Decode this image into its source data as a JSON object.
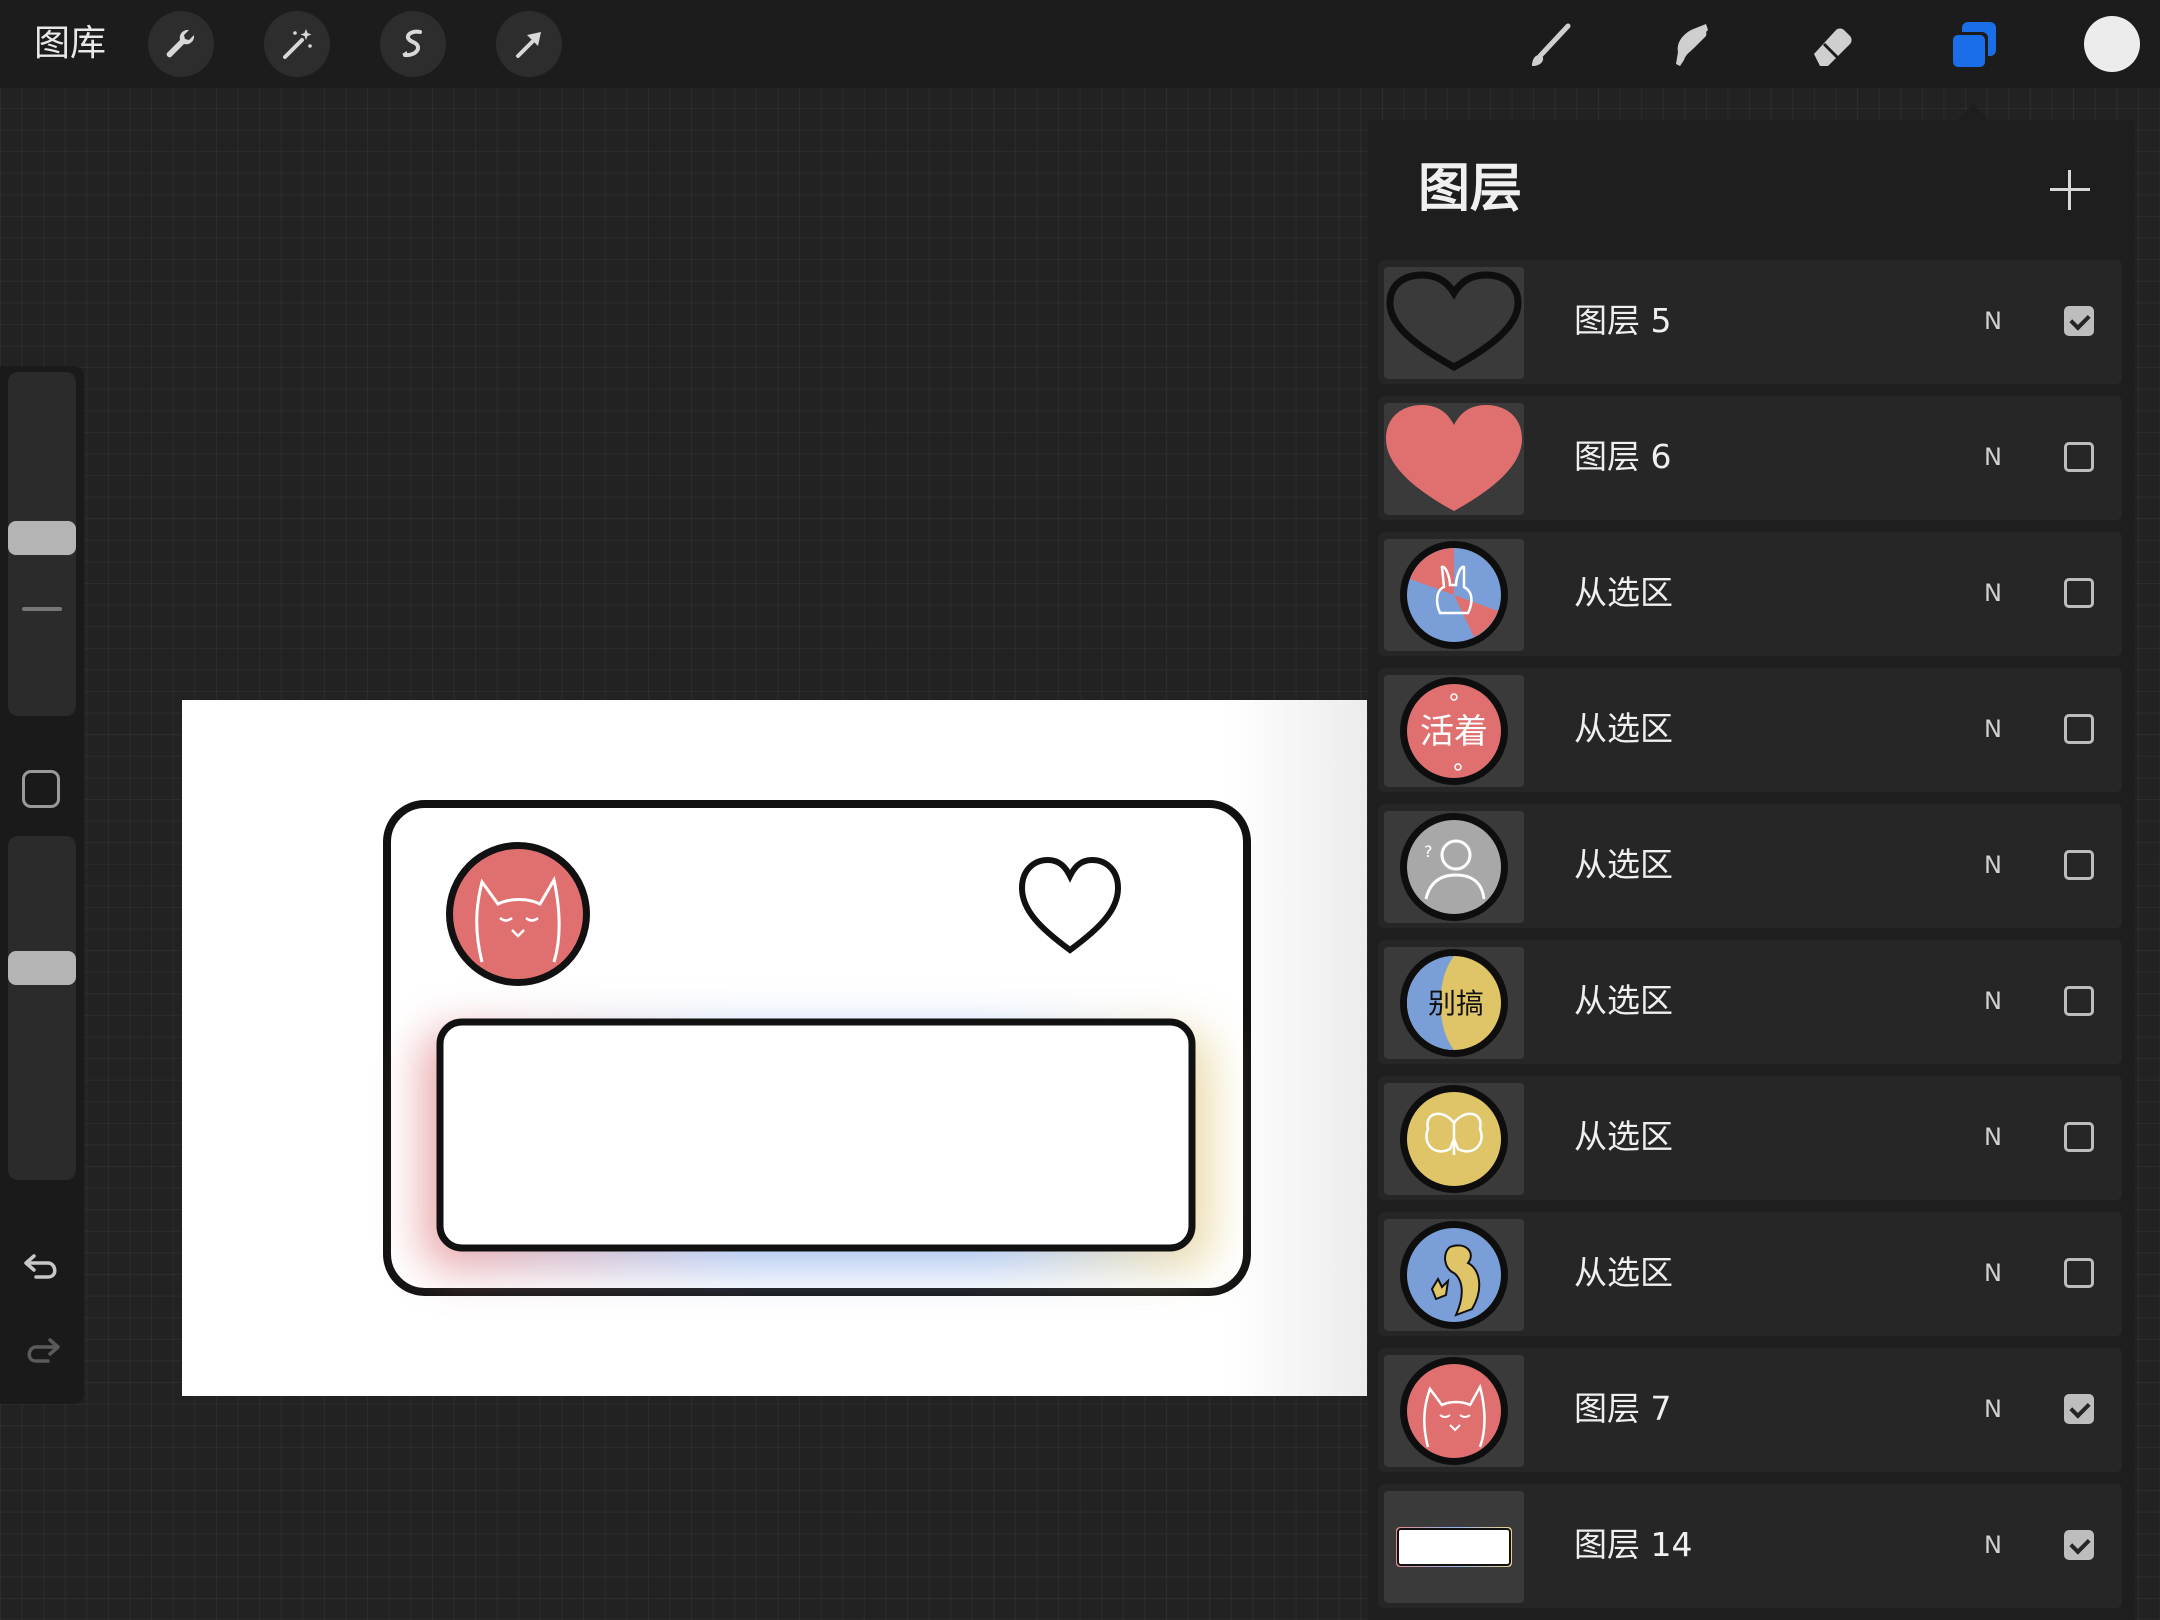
{
  "toolbar": {
    "gallery_label": "图库",
    "left_tools": [
      "wrench-icon",
      "magic-wand-icon",
      "selection-icon",
      "transform-arrow-icon"
    ],
    "right_tools": [
      "brush-icon",
      "smudge-icon",
      "eraser-icon",
      "layers-icon"
    ],
    "active_tool": "layers-icon",
    "active_color": "#ececec",
    "accent_color": "#1a6fe8"
  },
  "sidebar": {
    "brush_size_level": 0.52,
    "opacity_level": 0.63,
    "icons": [
      "modify-square-icon",
      "undo-icon",
      "redo-icon"
    ]
  },
  "layers_panel": {
    "title": "图层",
    "add_icon": "plus-icon",
    "layers": [
      {
        "name": "图层 5",
        "blend": "N",
        "visible": true,
        "thumb": "black-heart-outline"
      },
      {
        "name": "图层 6",
        "blend": "N",
        "visible": false,
        "thumb": "red-heart"
      },
      {
        "name": "从选区",
        "blend": "N",
        "visible": false,
        "thumb": "red-blue-rabbit-badge"
      },
      {
        "name": "从选区",
        "blend": "N",
        "visible": false,
        "thumb": "red-text-badge",
        "badge_text": "活着"
      },
      {
        "name": "从选区",
        "blend": "N",
        "visible": false,
        "thumb": "grey-avatar-badge"
      },
      {
        "name": "从选区",
        "blend": "N",
        "visible": false,
        "thumb": "blue-yellow-text-badge",
        "badge_text": "别搞"
      },
      {
        "name": "从选区",
        "blend": "N",
        "visible": false,
        "thumb": "yellow-butterfly-badge"
      },
      {
        "name": "从选区",
        "blend": "N",
        "visible": false,
        "thumb": "blue-figure-badge"
      },
      {
        "name": "图层 7",
        "blend": "N",
        "visible": true,
        "thumb": "red-cat-badge"
      },
      {
        "name": "图层 14",
        "blend": "N",
        "visible": true,
        "thumb": "white-rectangle"
      }
    ]
  },
  "canvas": {
    "colors": {
      "red": "#e07070",
      "blue": "#7a9fd8",
      "yellow": "#e0c468",
      "ink": "#111111"
    }
  }
}
